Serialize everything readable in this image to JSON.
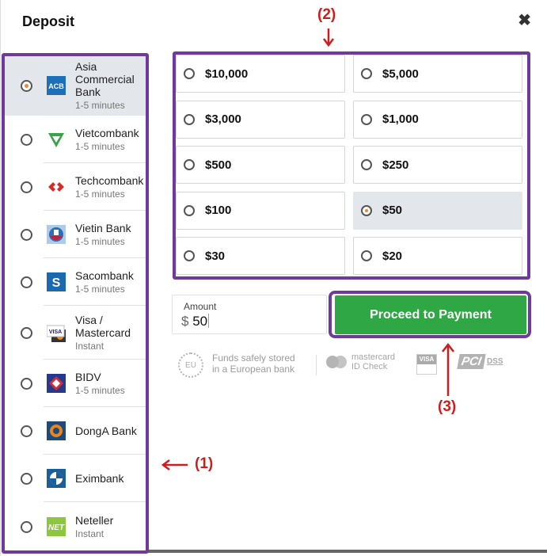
{
  "header": {
    "title": "Deposit",
    "close_icon": "close-icon"
  },
  "banks": [
    {
      "name": "Asia Commercial Bank",
      "eta": "1-5 minutes",
      "logo": "acb-logo",
      "logo_color": "#1d6fb8",
      "selected": true
    },
    {
      "name": "Vietcombank",
      "eta": "1-5 minutes",
      "logo": "vietcombank-logo",
      "logo_color": "#3aa348",
      "selected": false
    },
    {
      "name": "Techcombank",
      "eta": "1-5 minutes",
      "logo": "techcombank-logo",
      "logo_color": "#d52b2b",
      "selected": false
    },
    {
      "name": "Vietin Bank",
      "eta": "1-5 minutes",
      "logo": "vietinbank-logo",
      "logo_color": "#2d6fb5",
      "selected": false
    },
    {
      "name": "Sacombank",
      "eta": "1-5 minutes",
      "logo": "sacombank-logo",
      "logo_color": "#1a6ab0",
      "selected": false
    },
    {
      "name": "Visa / Mastercard",
      "eta": "Instant",
      "logo": "visa-mastercard-logo",
      "logo_color": "#1a1f71",
      "selected": false
    },
    {
      "name": "BIDV",
      "eta": "1-5 minutes",
      "logo": "bidv-logo",
      "logo_color": "#253a8c",
      "selected": false
    },
    {
      "name": "DongA Bank",
      "eta": "",
      "logo": "donga-bank-logo",
      "logo_color": "#e8861e",
      "selected": false
    },
    {
      "name": "Eximbank",
      "eta": "",
      "logo": "eximbank-logo",
      "logo_color": "#1a5e9a",
      "selected": false
    },
    {
      "name": "Neteller",
      "eta": "Instant",
      "logo": "neteller-logo",
      "logo_color": "#8dc63f",
      "selected": false
    }
  ],
  "amounts": [
    {
      "label": "$10,000",
      "selected": false
    },
    {
      "label": "$5,000",
      "selected": false
    },
    {
      "label": "$3,000",
      "selected": false
    },
    {
      "label": "$1,000",
      "selected": false
    },
    {
      "label": "$500",
      "selected": false
    },
    {
      "label": "$250",
      "selected": false
    },
    {
      "label": "$100",
      "selected": false
    },
    {
      "label": "$50",
      "selected": true
    },
    {
      "label": "$30",
      "selected": false
    },
    {
      "label": "$20",
      "selected": false
    }
  ],
  "amount_input": {
    "label": "Amount",
    "currency": "$",
    "value": "50"
  },
  "proceed_label": "Proceed to Payment",
  "trust": {
    "eu_badge": "EU",
    "funds_line1": "Funds safely stored",
    "funds_line2": "in a European bank",
    "mastercard_line1": "mastercard",
    "mastercard_line2": "ID Check",
    "visa_label": "VISA",
    "pci_label": "PCI",
    "dss_label": "DSS"
  },
  "annotations": {
    "a1": "(1)",
    "a2": "(2)",
    "a3": "(3)",
    "color": "#d01c1c",
    "highlight_color": "#6f3b9a"
  }
}
